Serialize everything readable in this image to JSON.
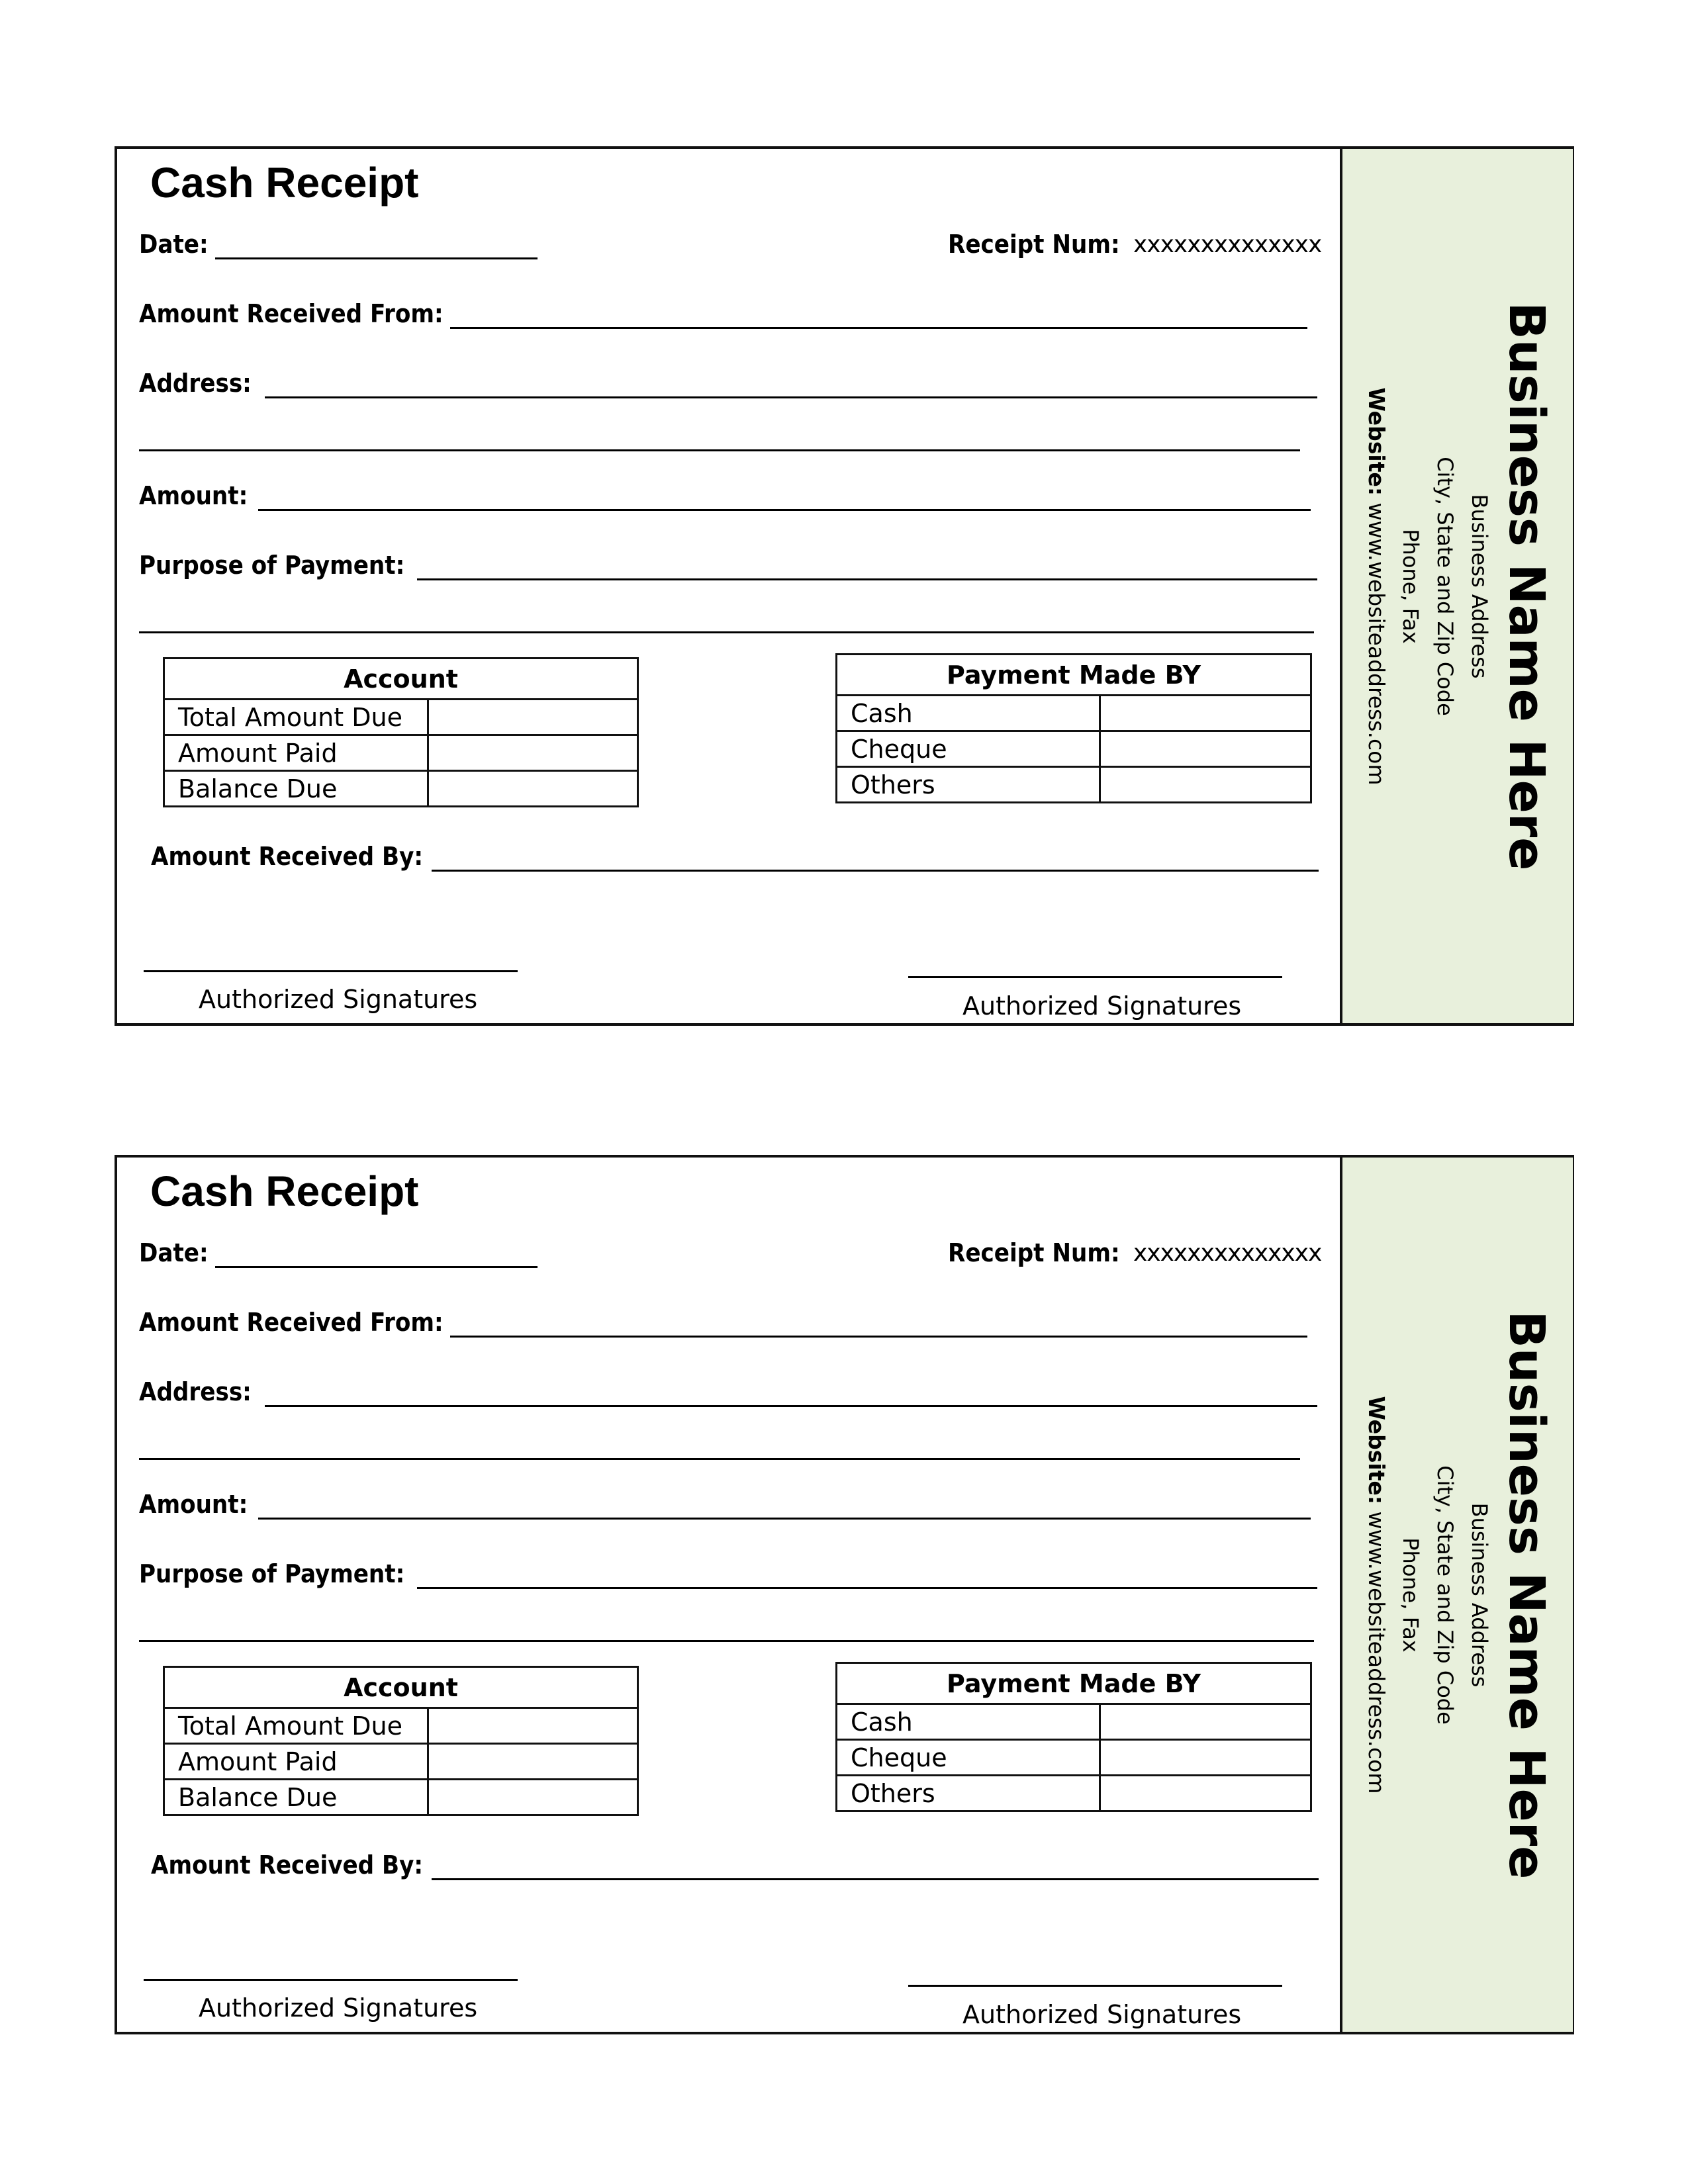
{
  "receipts": [
    {
      "title": "Cash Receipt",
      "date_label": "Date:",
      "receipt_num_label": "Receipt Num:",
      "receipt_num_value": "xxxxxxxxxxxxxx",
      "received_from_label": "Amount Received From:",
      "address_label": "Address:",
      "amount_label": "Amount:",
      "purpose_label": "Purpose of Payment:",
      "account_table": {
        "header": "Account",
        "rows": [
          {
            "label": "Total Amount Due",
            "value": ""
          },
          {
            "label": "Amount Paid",
            "value": ""
          },
          {
            "label": "Balance Due",
            "value": ""
          }
        ]
      },
      "payment_table": {
        "header": "Payment Made BY",
        "rows": [
          {
            "label": "Cash",
            "value": ""
          },
          {
            "label": "Cheque",
            "value": ""
          },
          {
            "label": "Others",
            "value": ""
          }
        ]
      },
      "received_by_label": "Amount Received By:",
      "signature_left_label": "Authorized Signatures",
      "signature_right_label": "Authorized Signatures",
      "side_panel": {
        "business_name": "Business Name Here",
        "address_line": "Business Address",
        "city_line": "City, State and Zip Code",
        "phone_line": "Phone, Fax",
        "website_label": "Website:",
        "website_value": "www.websiteaddress.com",
        "background_color": "#e8f0dc"
      }
    },
    {
      "title": "Cash Receipt",
      "date_label": "Date:",
      "receipt_num_label": "Receipt Num:",
      "receipt_num_value": "xxxxxxxxxxxxxx",
      "received_from_label": "Amount Received From:",
      "address_label": "Address:",
      "amount_label": "Amount:",
      "purpose_label": "Purpose of Payment:",
      "account_table": {
        "header": "Account",
        "rows": [
          {
            "label": "Total Amount Due",
            "value": ""
          },
          {
            "label": "Amount Paid",
            "value": ""
          },
          {
            "label": "Balance Due",
            "value": ""
          }
        ]
      },
      "payment_table": {
        "header": "Payment Made BY",
        "rows": [
          {
            "label": "Cash",
            "value": ""
          },
          {
            "label": "Cheque",
            "value": ""
          },
          {
            "label": "Others",
            "value": ""
          }
        ]
      },
      "received_by_label": "Amount Received By:",
      "signature_left_label": "Authorized Signatures",
      "signature_right_label": "Authorized Signatures",
      "side_panel": {
        "business_name": "Business Name Here",
        "address_line": "Business Address",
        "city_line": "City, State and Zip Code",
        "phone_line": "Phone, Fax",
        "website_label": "Website:",
        "website_value": "www.websiteaddress.com",
        "background_color": "#e8f0dc"
      }
    }
  ]
}
